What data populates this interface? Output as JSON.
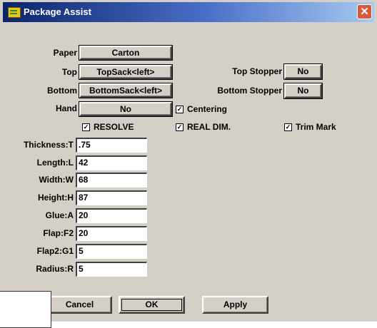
{
  "window": {
    "title": "Package Assist",
    "close_glyph": "✕",
    "app_icon": "package-assist-icon"
  },
  "rows": {
    "paper": {
      "label": "Paper",
      "value": "Carton"
    },
    "top": {
      "label": "Top",
      "value": "TopSack<left>"
    },
    "bottom": {
      "label": "Bottom",
      "value": "BottomSack<left>"
    },
    "hand": {
      "label": "Hand",
      "value": "No"
    },
    "top_stopper": {
      "label": "Top Stopper",
      "value": "No"
    },
    "bottom_stopper": {
      "label": "Bottom Stopper",
      "value": "No"
    }
  },
  "checkboxes": {
    "centering": {
      "label": "Centering",
      "checked": true,
      "mark": "✓"
    },
    "resolve": {
      "label": "RESOLVE",
      "checked": true,
      "mark": "✓"
    },
    "real_dim": {
      "label": "REAL DIM.",
      "checked": true,
      "mark": "✓"
    },
    "trim_mark": {
      "label": "Trim Mark",
      "checked": true,
      "mark": "✓"
    }
  },
  "fields": [
    {
      "label": "Thickness:T",
      "value": ".75"
    },
    {
      "label": "Length:L",
      "value": "42"
    },
    {
      "label": "Width:W",
      "value": "68"
    },
    {
      "label": "Height:H",
      "value": "87"
    },
    {
      "label": "Glue:A",
      "value": "20"
    },
    {
      "label": "Flap:F2",
      "value": "20"
    },
    {
      "label": "Flap2:G1",
      "value": "5"
    },
    {
      "label": "Radius:R",
      "value": "5"
    }
  ],
  "buttons": {
    "cancel": "Cancel",
    "ok": "OK",
    "apply": "Apply"
  }
}
